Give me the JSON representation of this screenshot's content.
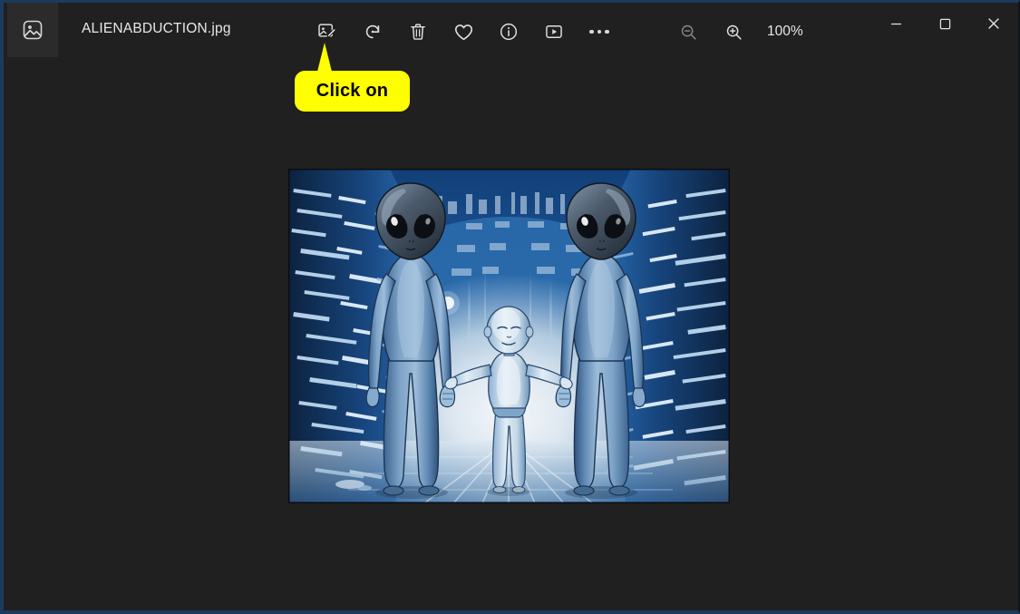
{
  "window": {
    "background_color": "#202020",
    "border_color": "#1c3a5c",
    "app_name": "Photos"
  },
  "titlebar": {
    "app_icon": "photo-app-icon",
    "filename": "ALIENABDUCTION.jpg"
  },
  "toolbar": {
    "buttons": [
      {
        "name": "edit-image",
        "label": "Edit image",
        "icon": "image-pencil-icon",
        "enabled": true
      },
      {
        "name": "rotate",
        "label": "Rotate",
        "icon": "rotate-icon",
        "enabled": true
      },
      {
        "name": "delete",
        "label": "Delete",
        "icon": "trash-icon",
        "enabled": true
      },
      {
        "name": "favorite",
        "label": "Add to favorites",
        "icon": "heart-icon",
        "enabled": true
      },
      {
        "name": "info",
        "label": "File info",
        "icon": "info-circle-icon",
        "enabled": true
      },
      {
        "name": "slideshow",
        "label": "Slideshow",
        "icon": "play-box-icon",
        "enabled": true
      },
      {
        "name": "see-more",
        "label": "See more",
        "icon": "ellipsis-icon",
        "enabled": true
      }
    ],
    "zoom_out": {
      "name": "zoom-out",
      "label": "Zoom out",
      "icon": "magnifier-minus-icon",
      "enabled": false
    },
    "zoom_in": {
      "name": "zoom-in",
      "label": "Zoom in",
      "icon": "magnifier-plus-icon",
      "enabled": true
    },
    "zoom_level": "100%"
  },
  "window_controls": {
    "minimize": {
      "label": "Minimize",
      "icon": "minimize-icon"
    },
    "maximize": {
      "label": "Maximize",
      "icon": "maximize-icon"
    },
    "close": {
      "label": "Close",
      "icon": "close-icon"
    }
  },
  "callout": {
    "text": "Click on",
    "background_color": "#ffff00",
    "text_color": "#000000",
    "points_at": "edit-image"
  },
  "image": {
    "alt": "Two tall grey-blue aliens holding hands with a small human child standing between them, backlit by bright light in a blue futuristic cityscape corridor",
    "zoom": "100%",
    "colors": {
      "sky": "#1c5fa8",
      "alien_body": "#5e87b5",
      "alien_head": "#3a4450",
      "light": "#e8eef4",
      "frame": "#05070c"
    }
  }
}
